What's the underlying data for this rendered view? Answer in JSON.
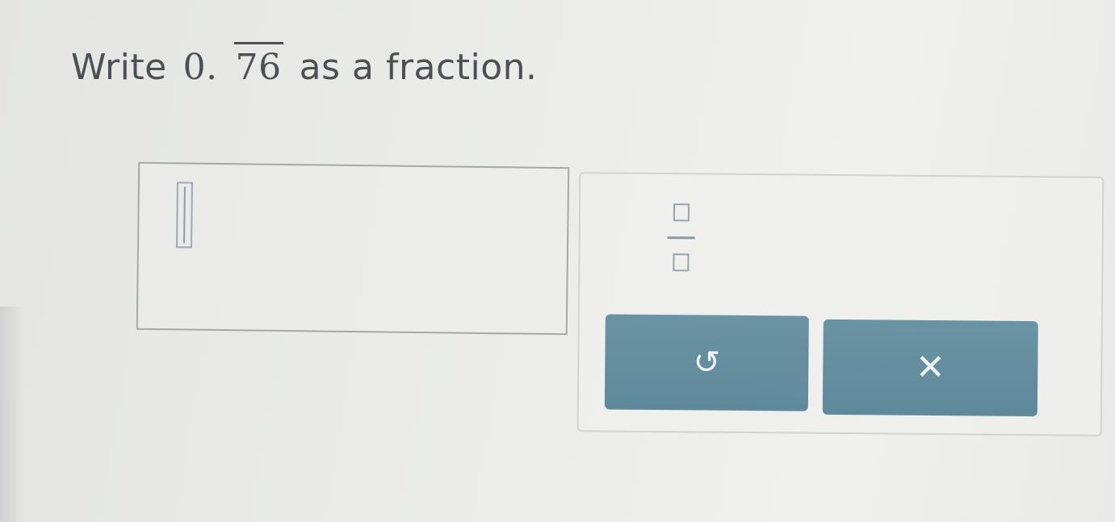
{
  "question": {
    "prefix": "Write",
    "whole_part": "0.",
    "repeating_digits": "76",
    "suffix": "as a fraction."
  },
  "answer": {
    "value": ""
  },
  "keypad": {
    "fraction_key": {
      "icon": "fraction-template-icon"
    },
    "undo_button": {
      "icon": "undo-icon",
      "glyph": "↺"
    },
    "clear_button": {
      "icon": "close-icon",
      "glyph": "✕"
    }
  },
  "colors": {
    "text": "#4d5052",
    "button": "#6290a1",
    "button_icon": "#eef3f5",
    "border": "#a5a7a8"
  }
}
